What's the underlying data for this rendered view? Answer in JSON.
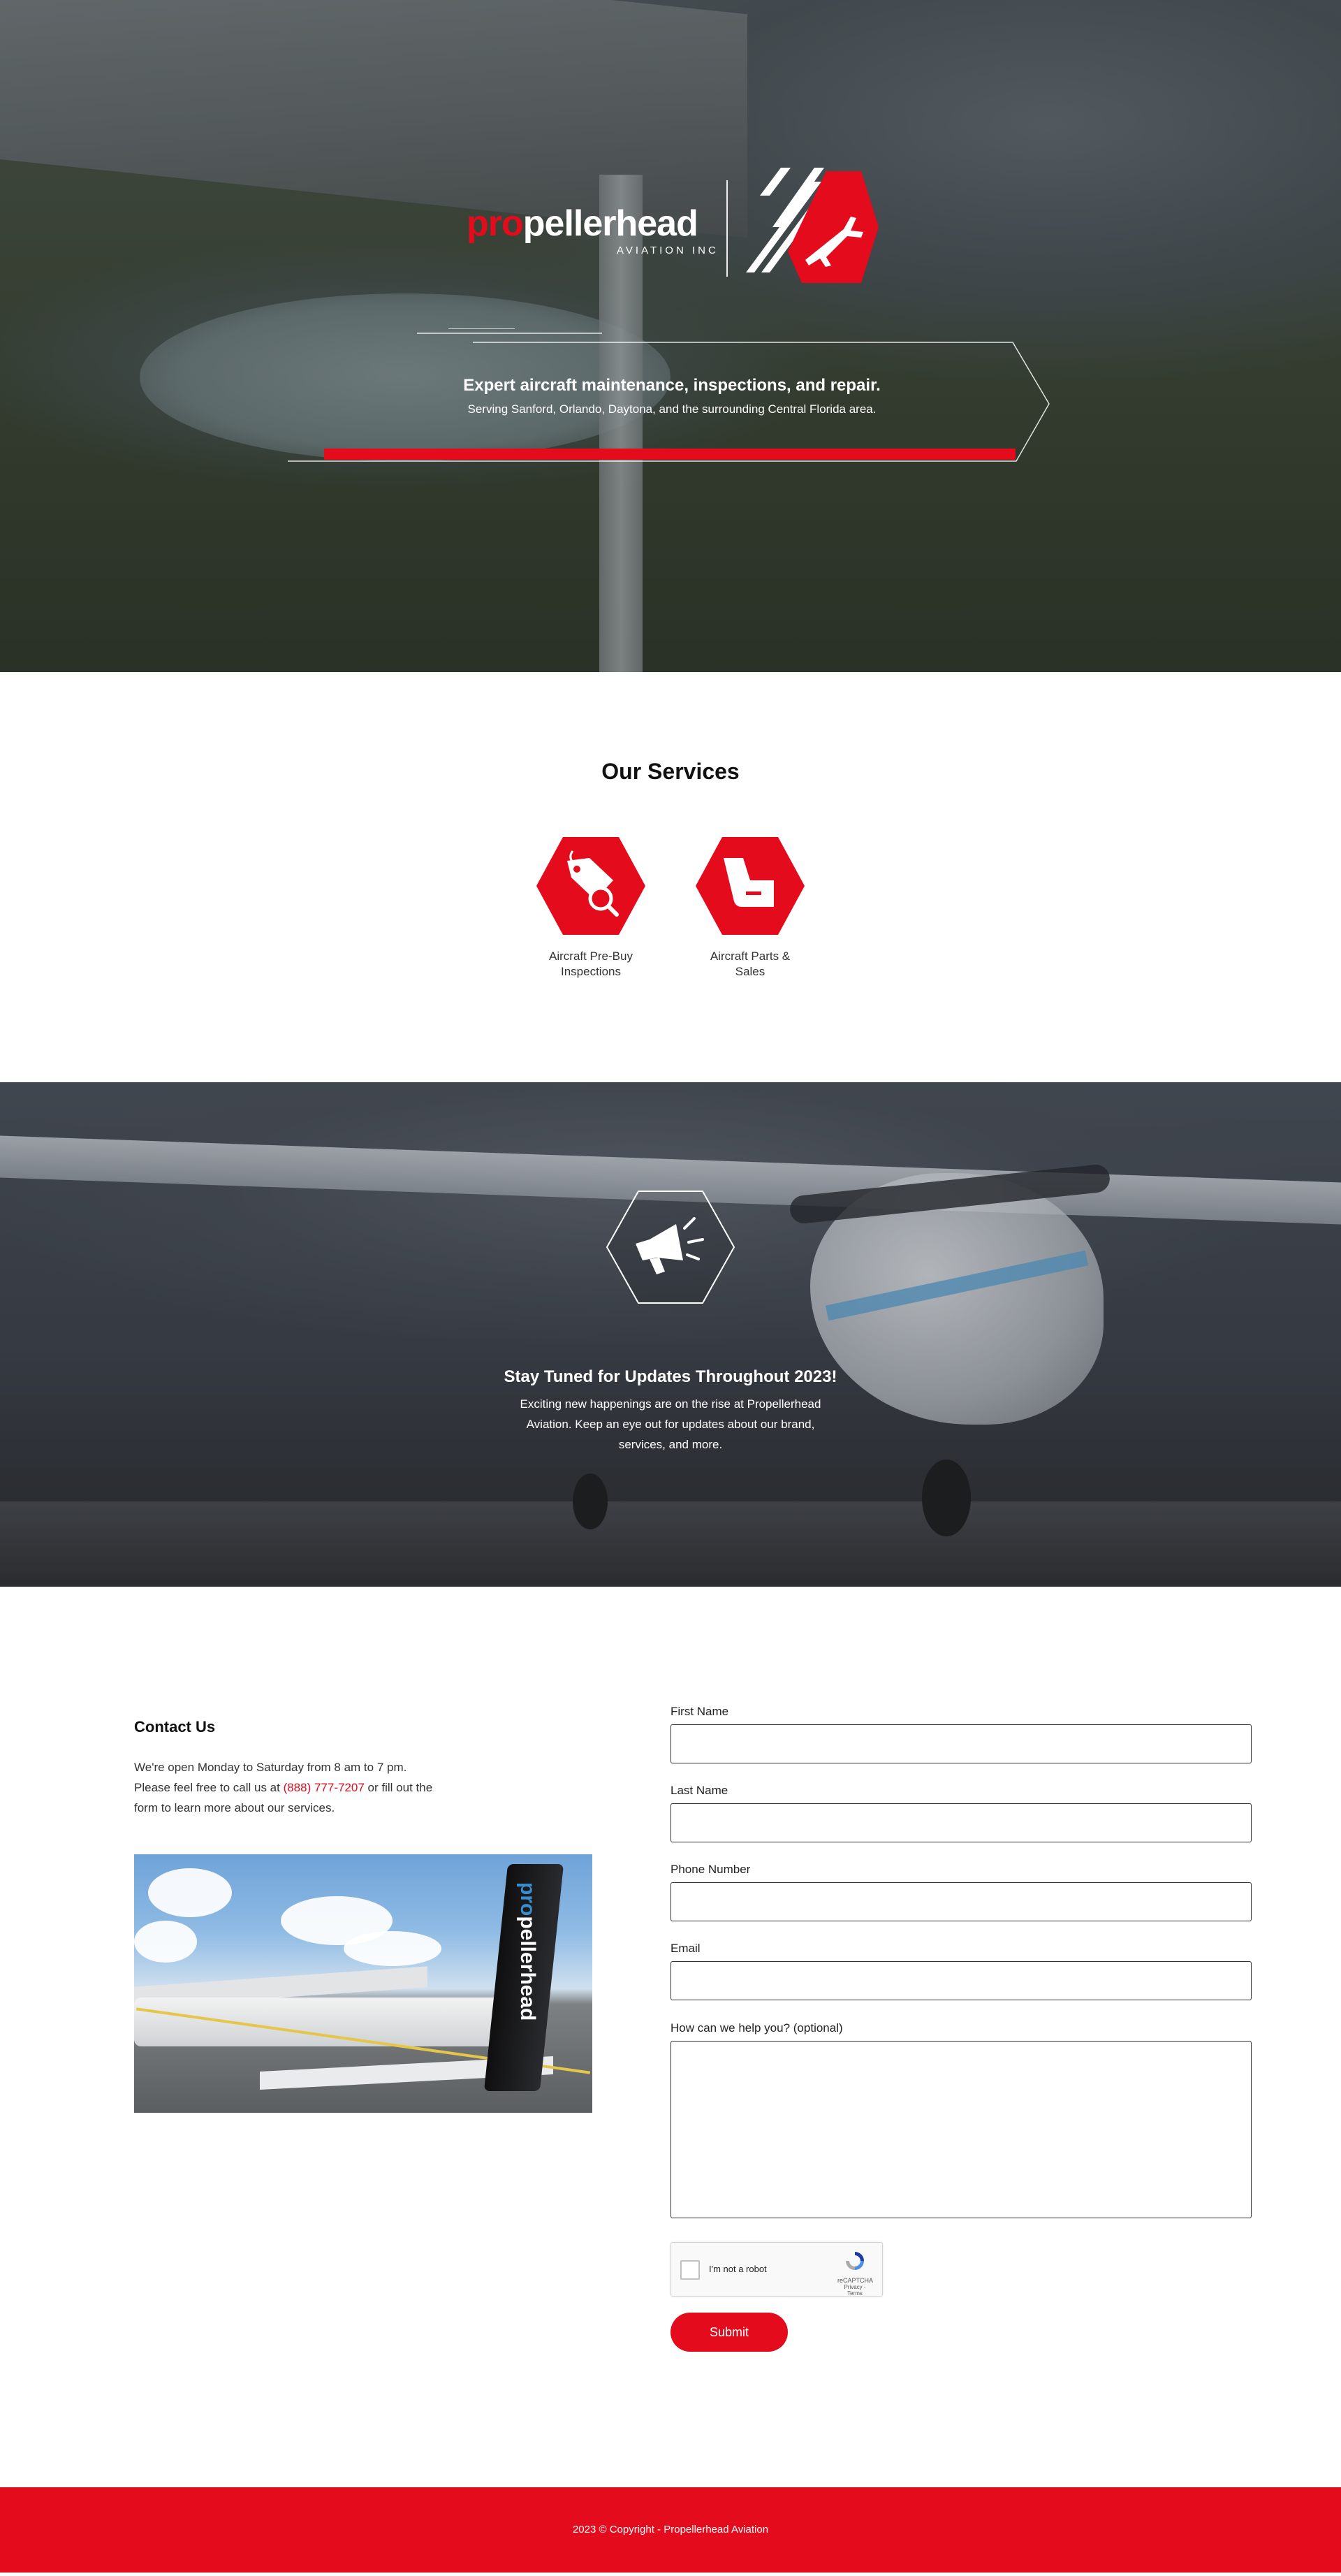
{
  "brand": {
    "name_red": "pro",
    "name_white": "pellerhead",
    "subtitle": "AVIATION   INC",
    "accent_color": "#e30b1c",
    "logo_icon": "airplane-hexagon-icon"
  },
  "hero": {
    "headline": "Expert aircraft maintenance, inspections, and repair.",
    "subline": "Serving Sanford, Orlando, Daytona, and the surrounding Central Florida area."
  },
  "services": {
    "title": "Our Services",
    "items": [
      {
        "label": "Aircraft Pre-Buy Inspections",
        "icon": "tag-magnifier-icon"
      },
      {
        "label": "Aircraft Parts & Sales",
        "icon": "aircraft-seat-icon"
      }
    ]
  },
  "updates": {
    "icon": "megaphone-icon",
    "title": "Stay Tuned for Updates Throughout 2023!",
    "body": "Exciting new happenings are on the rise at Propellerhead Aviation. Keep an eye out for updates about our brand, services, and more."
  },
  "contact": {
    "title": "Contact Us",
    "text_before": "We're open Monday to Saturday from 8 am to 7 pm. Please feel free to call us at ",
    "phone": "(888) 777-7207",
    "text_after": " or fill out the form to learn more about our services.",
    "photo_tail_text_blue": "pro",
    "photo_tail_text_white": "pellerhead"
  },
  "form": {
    "fields": [
      {
        "label": "First Name",
        "value": ""
      },
      {
        "label": "Last Name",
        "value": ""
      },
      {
        "label": "Phone Number",
        "value": ""
      },
      {
        "label": "Email",
        "value": ""
      },
      {
        "label": "How can we help you? (optional)",
        "value": ""
      }
    ],
    "recaptcha": {
      "label": "I'm not a robot",
      "brand": "reCAPTCHA",
      "links": "Privacy - Terms"
    },
    "submit_label": "Submit"
  },
  "footer": {
    "copyright": "2023 © Copyright - Propellerhead Aviation"
  }
}
